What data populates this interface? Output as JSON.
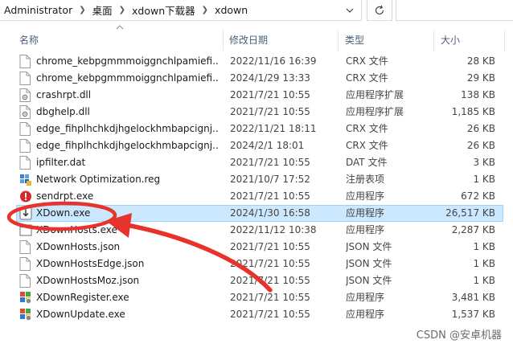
{
  "breadcrumb": {
    "items": [
      "Administrator",
      "桌面",
      "xdown下载器",
      "xdown"
    ]
  },
  "columns": {
    "name": "名称",
    "date": "修改日期",
    "type": "类型",
    "size": "大小"
  },
  "files": [
    {
      "name": "chrome_kebpgmmmoiggnchlpamiefi...",
      "date": "2022/11/16 16:39",
      "type": "CRX 文件",
      "size": "28 KB",
      "icon": "generic-file-icon"
    },
    {
      "name": "chrome_kebpgmmmoiggnchlpamiefi...",
      "date": "2024/1/29 13:33",
      "type": "CRX 文件",
      "size": "29 KB",
      "icon": "generic-file-icon"
    },
    {
      "name": "crashrpt.dll",
      "date": "2021/7/21 10:55",
      "type": "应用程序扩展",
      "size": "138 KB",
      "icon": "dll-file-icon"
    },
    {
      "name": "dbghelp.dll",
      "date": "2021/7/21 10:55",
      "type": "应用程序扩展",
      "size": "1,185 KB",
      "icon": "dll-file-icon"
    },
    {
      "name": "edge_fihplhchkdjhgelockhmbapcignj...",
      "date": "2022/11/21 18:11",
      "type": "CRX 文件",
      "size": "26 KB",
      "icon": "generic-file-icon"
    },
    {
      "name": "edge_fihplhchkdjhgelockhmbapcignj...",
      "date": "2024/2/1 18:01",
      "type": "CRX 文件",
      "size": "26 KB",
      "icon": "generic-file-icon"
    },
    {
      "name": "ipfilter.dat",
      "date": "2021/7/21 10:55",
      "type": "DAT 文件",
      "size": "3 KB",
      "icon": "generic-file-icon"
    },
    {
      "name": "Network Optimization.reg",
      "date": "2021/10/7 17:52",
      "type": "注册表项",
      "size": "1 KB",
      "icon": "registry-file-icon"
    },
    {
      "name": "sendrpt.exe",
      "date": "2021/7/21 10:55",
      "type": "应用程序",
      "size": "672 KB",
      "icon": "error-app-icon"
    },
    {
      "name": "XDown.exe",
      "date": "2024/1/30 16:58",
      "type": "应用程序",
      "size": "26,517 KB",
      "icon": "xdown-app-icon",
      "selected": true
    },
    {
      "name": "XDownHosts.exe",
      "date": "2022/11/12 10:38",
      "type": "应用程序",
      "size": "2,287 KB",
      "icon": "app-icon"
    },
    {
      "name": "XDownHosts.json",
      "date": "2021/7/21 10:55",
      "type": "JSON 文件",
      "size": "1 KB",
      "icon": "generic-file-icon"
    },
    {
      "name": "XDownHostsEdge.json",
      "date": "2021/7/21 10:55",
      "type": "JSON 文件",
      "size": "1 KB",
      "icon": "generic-file-icon"
    },
    {
      "name": "XDownHostsMoz.json",
      "date": "2021/7/21 10:55",
      "type": "JSON 文件",
      "size": "1 KB",
      "icon": "generic-file-icon"
    },
    {
      "name": "XDownRegister.exe",
      "date": "2021/7/21 10:55",
      "type": "应用程序",
      "size": "3,481 KB",
      "icon": "installer-app-icon"
    },
    {
      "name": "XDownUpdate.exe",
      "date": "2021/7/21 10:55",
      "type": "应用程序",
      "size": "1,537 KB",
      "icon": "installer-app-icon"
    }
  ],
  "watermark": "CSDN @安卓机器",
  "colors": {
    "selection_bg": "#cce8ff",
    "selection_border": "#99d1ff",
    "annotation_red": "#e8332c",
    "header_text": "#4c607a"
  }
}
